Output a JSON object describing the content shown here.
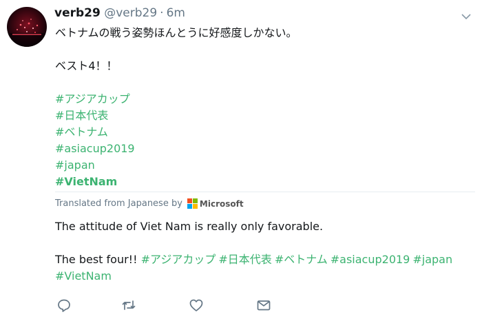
{
  "tweet": {
    "display_name": "verb29",
    "handle": "@verb29",
    "separator": "·",
    "time": "6m",
    "lines": [
      "ベトナムの戦う姿勢ほんとうに好感度しかない。",
      "ベスト4！！"
    ],
    "hashtags": [
      "#アジアカップ",
      "#日本代表",
      "#ベトナム",
      "#asiacup2019",
      "#japan",
      "#VietNam"
    ]
  },
  "translation": {
    "label": "Translated from Japanese by",
    "provider": "Microsoft",
    "line1": "The attitude of Viet Nam is really only favorable.",
    "line2_prefix": "The best four!!",
    "line2_hashtags": [
      "#アジアカップ",
      "#日本代表",
      "#ベトナム",
      "#asiacup2019",
      "#japan"
    ],
    "line3_hashtag": "#VietNam"
  },
  "colors": {
    "hashtag": "#3cb371",
    "muted": "#657786",
    "divider": "#e6ecf0",
    "ms_red": "#f25022",
    "ms_green": "#7fba00",
    "ms_blue": "#00a4ef",
    "ms_yellow": "#ffb900"
  },
  "actions": [
    "reply-icon",
    "retweet-icon",
    "like-icon",
    "dm-icon"
  ]
}
